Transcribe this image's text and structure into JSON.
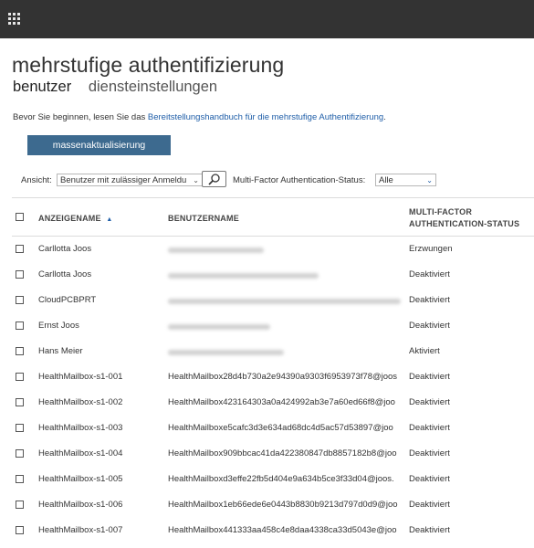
{
  "app": {
    "title": "mehrstufige authentifizierung",
    "tabs": [
      {
        "label": "benutzer",
        "active": true
      },
      {
        "label": "diensteinstellungen",
        "active": false
      }
    ]
  },
  "intro": {
    "prefix": "Bevor Sie beginnen, lesen Sie das ",
    "link": "Bereitstellungshandbuch für die mehrstufige Authentifizierung",
    "suffix": "."
  },
  "bulk_update_label": "massenaktualisierung",
  "filter": {
    "view_label": "Ansicht:",
    "view_value": "Benutzer mit zulässiger Anmeldu",
    "mfa_label": "Multi-Factor Authentication-Status:",
    "mfa_value": "Alle"
  },
  "table": {
    "headers": {
      "display_name": "ANZEIGENAME",
      "user_name": "BENUTZERNAME",
      "mfa_status_line1": "MULTI-FACTOR",
      "mfa_status_line2": "AUTHENTICATION-STATUS"
    },
    "rows": [
      {
        "name": "Carllotta Joos",
        "user": "",
        "status": "Erzwungen"
      },
      {
        "name": "Carllotta Joos",
        "user": "",
        "status": "Deaktiviert"
      },
      {
        "name": "CloudPCBPRT",
        "user": "",
        "status": "Deaktiviert"
      },
      {
        "name": "Ernst Joos",
        "user": "",
        "status": "Deaktiviert"
      },
      {
        "name": "Hans Meier",
        "user": "",
        "status": "Aktiviert"
      },
      {
        "name": "HealthMailbox-s1-001",
        "user": "HealthMailbox28d4b730a2e94390a9303f6953973f78@joos",
        "status": "Deaktiviert"
      },
      {
        "name": "HealthMailbox-s1-002",
        "user": "HealthMailbox423164303a0a424992ab3e7a60ed66f8@joo",
        "status": "Deaktiviert"
      },
      {
        "name": "HealthMailbox-s1-003",
        "user": "HealthMailboxe5cafc3d3e634ad68dc4d5ac57d53897@joo",
        "status": "Deaktiviert"
      },
      {
        "name": "HealthMailbox-s1-004",
        "user": "HealthMailbox909bbcac41da422380847db8857182b8@joo",
        "status": "Deaktiviert"
      },
      {
        "name": "HealthMailbox-s1-005",
        "user": "HealthMailboxd3effe22fb5d404e9a634b5ce3f33d04@joos.",
        "status": "Deaktiviert"
      },
      {
        "name": "HealthMailbox-s1-006",
        "user": "HealthMailbox1eb66ede6e0443b8830b9213d797d0d9@joo",
        "status": "Deaktiviert"
      },
      {
        "name": "HealthMailbox-s1-007",
        "user": "HealthMailbox441333aa458c4e8daa4338ca33d5043e@joo",
        "status": "Deaktiviert"
      }
    ]
  },
  "icons": {
    "app_launcher": "waffle-icon",
    "search": "search-icon",
    "sort": "sort-ascending-icon",
    "dropdown": "chevron-down-icon"
  },
  "colors": {
    "topbar": "#333333",
    "primary_button": "#3d6a8f",
    "link": "#1f5ea8"
  }
}
